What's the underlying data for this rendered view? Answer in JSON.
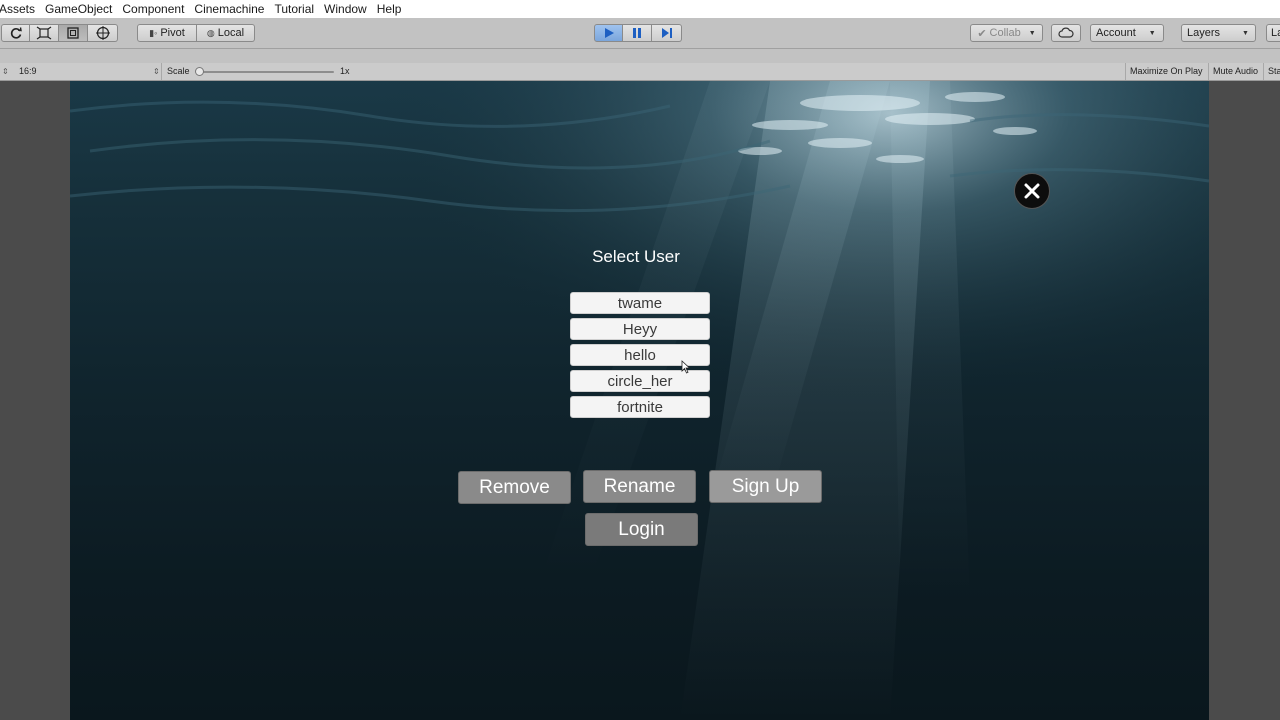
{
  "menubar": {
    "items": [
      "Assets",
      "GameObject",
      "Component",
      "Cinemachine",
      "Tutorial",
      "Window",
      "Help"
    ]
  },
  "toolbar": {
    "pivot_label": "Pivot",
    "local_label": "Local",
    "collab_label": "Collab",
    "account_label": "Account",
    "layers_label": "Layers",
    "layout_label": "La",
    "play_color": "#5b8fd6"
  },
  "gamebar": {
    "aspect": "16:9",
    "scale_label": "Scale",
    "scale_value": "1x",
    "maximize_on_play": "Maximize On Play",
    "mute_audio": "Mute Audio",
    "stats": "Sta"
  },
  "game": {
    "title": "Select User",
    "users": [
      {
        "label": "twame"
      },
      {
        "label": "Heyy"
      },
      {
        "label": "hello"
      },
      {
        "label": "circle_her"
      },
      {
        "label": "fortnite"
      }
    ],
    "buttons": {
      "remove": "Remove",
      "rename": "Rename",
      "signup": "Sign Up",
      "login": "Login"
    }
  }
}
